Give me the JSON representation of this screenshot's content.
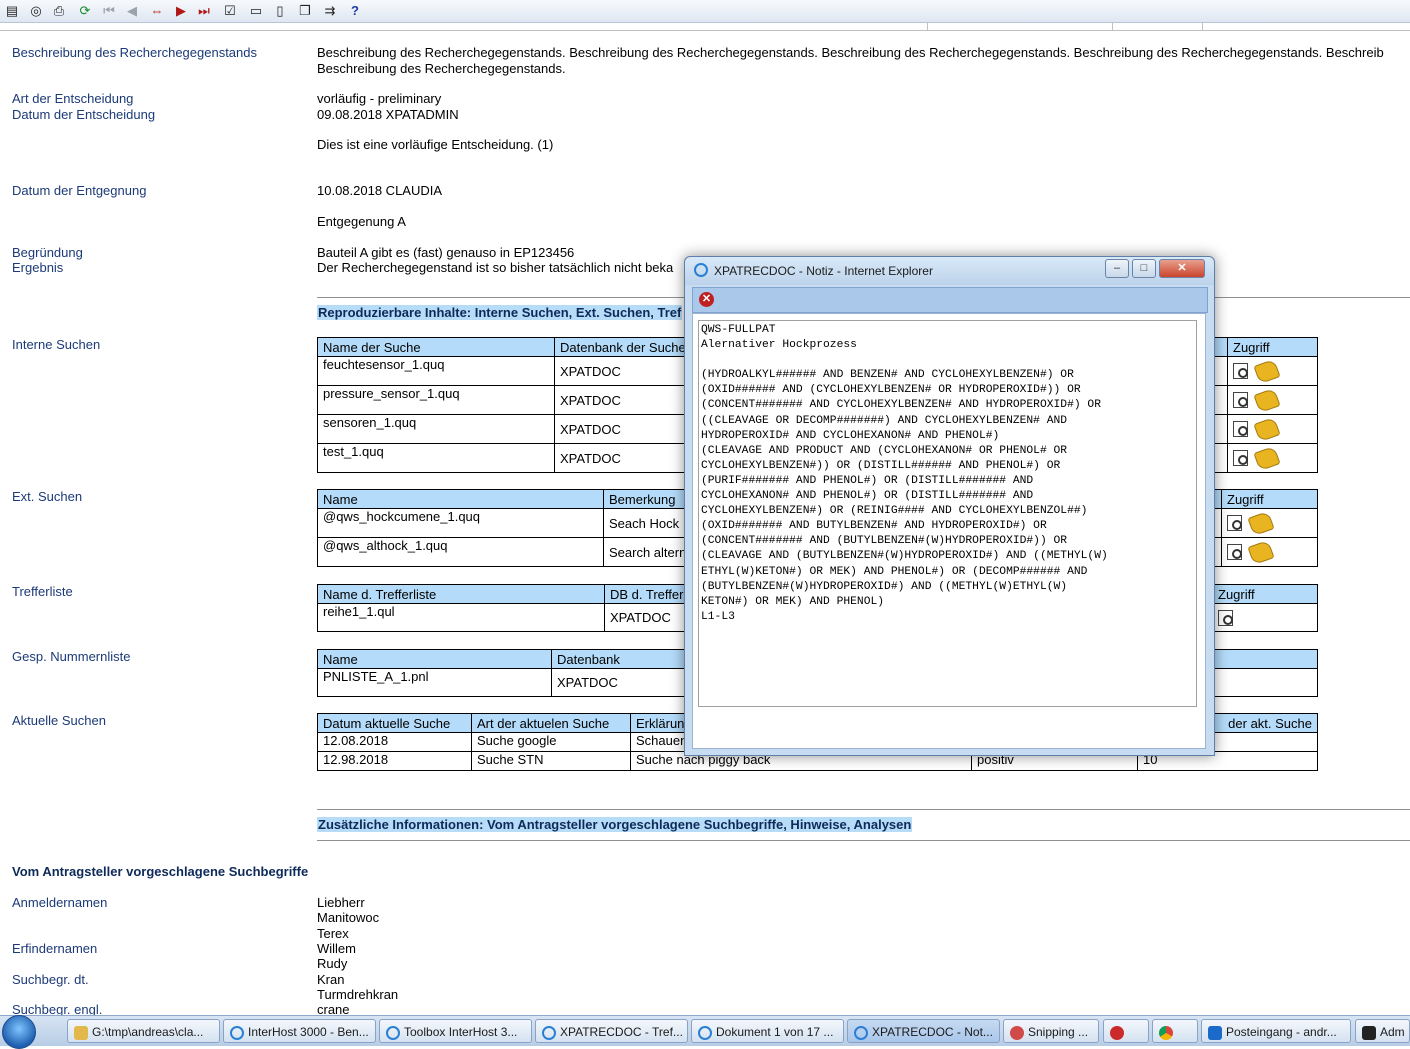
{
  "toolbar": {
    "icons": [
      "save-icon",
      "binoculars-icon",
      "print-icon",
      "refresh-icon",
      "first-icon",
      "prev-icon",
      "swap-icon",
      "next-icon",
      "last-icon",
      "edit-icon",
      "folder-icon",
      "document-icon",
      "copy-icon",
      "search-forward-icon",
      "help-icon"
    ],
    "help_glyph": "?"
  },
  "fields": {
    "beschreibung_label": "Beschreibung des Recherchegegenstands",
    "beschreibung_line1": "Beschreibung des Recherchegegenstands. Beschreibung des Recherchegegenstands. Beschreibung des Recherchegegenstands. Beschreibung des Recherchegegenstands. Beschreib",
    "beschreibung_line2": "Beschreibung des Recherchegegenstands.",
    "art_label": "Art der Entscheidung",
    "art_value": "vorläufig - preliminary",
    "datum_label": "Datum der Entscheidung",
    "datum_value": "09.08.2018  XPATADMIN",
    "entscheidung_text": "Dies ist eine vorläufige Entscheidung. (1)",
    "entgegnung_label": "Datum der Entgegnung",
    "entgegnung_value": "10.08.2018  CLAUDIA",
    "entgegnung_text": "Entgegenung A",
    "begruendung_label": "Begründung",
    "begruendung_value": "Bauteil A gibt es (fast) genauso in EP123456",
    "ergebnis_label": "Ergebnis",
    "ergebnis_value": "Der Recherchegegenstand ist so bisher tatsächlich nicht beka"
  },
  "sections": {
    "reproduzierbar": "Reproduzierbare Inhalte: Interne Suchen, Ext. Suchen, Tref",
    "zusatz": "Zusätzliche Informationen: Vom Antragsteller vorgeschlagene Suchbegriffe, Hinweise, Analysen"
  },
  "interne": {
    "label": "Interne Suchen",
    "headers": [
      "Name der Suche",
      "Datenbank der Suche",
      "Zugriff"
    ],
    "rows": [
      {
        "name": "feuchtesensor_1.quq",
        "db": "XPATDOC"
      },
      {
        "name": "pressure_sensor_1.quq",
        "db": "XPATDOC"
      },
      {
        "name": "sensoren_1.quq",
        "db": "XPATDOC"
      },
      {
        "name": "test_1.quq",
        "db": "XPATDOC"
      }
    ]
  },
  "ext": {
    "label": "Ext. Suchen",
    "headers": [
      "Name",
      "Bemerkung",
      "Zugriff"
    ],
    "rows": [
      {
        "name": "@qws_hockcumene_1.quq",
        "bem": "Seach Hock"
      },
      {
        "name": "@qws_althock_1.quq",
        "bem": "Search altern"
      }
    ]
  },
  "treffer": {
    "label": "Trefferliste",
    "headers": [
      "Name d. Trefferliste",
      "DB d. Trefferliste",
      "Zugriff"
    ],
    "rows": [
      {
        "name": "reihe1_1.qul",
        "db": "XPATDOC"
      }
    ]
  },
  "nummern": {
    "label": "Gesp. Nummernliste",
    "headers": [
      "Name",
      "Datenbank"
    ],
    "rows": [
      {
        "name": "PNLISTE_A_1.pnl",
        "db": "XPATDOC"
      }
    ]
  },
  "aktuelle": {
    "label": "Aktuelle Suchen",
    "headers": [
      "Datum aktuelle Suche",
      "Art der aktuelen Suche",
      "Erklärung",
      "",
      "der akt. Suche"
    ],
    "rows": [
      {
        "datum": "12.08.2018",
        "art": "Suche google",
        "erkl": "Schauen",
        "c4": "",
        "c5": ""
      },
      {
        "datum": "12.98.2018",
        "art": "Suche STN",
        "erkl": "Suche nach piggy back",
        "c4": "positiv",
        "c5": "10"
      }
    ]
  },
  "vorschlag": {
    "heading": "Vom Antragsteller vorgeschlagene Suchbegriffe",
    "anmelder_label": "Anmeldernamen",
    "anmelder": [
      "Liebherr",
      "Manitowoc",
      "Terex"
    ],
    "erfinder_label": "Erfindernamen",
    "erfinder": [
      "Willem",
      "Rudy"
    ],
    "dt_label": "Suchbegr. dt.",
    "dt": [
      "Kran",
      "Turmdrehkran"
    ],
    "engl_label": "Suchbegr. engl.",
    "engl": [
      "crane"
    ]
  },
  "popup": {
    "title": "XPATRECDOC - Notiz - Internet Explorer",
    "note": "QWS-FULLPAT\nAlernativer Hockprozess\n\n(HYDROALKYL###### AND BENZEN# AND CYCLOHEXYLBENZEN#) OR\n(OXID###### AND (CYCLOHEXYLBENZEN# OR HYDROPEROXID#)) OR\n(CONCENT####### AND CYCLOHEXYLBENZEN# AND HYDROPEROXID#) OR\n((CLEAVAGE OR DECOMP#######) AND CYCLOHEXYLBENZEN# AND\nHYDROPEROXID# AND CYCLOHEXANON# AND PHENOL#)\n(CLEAVAGE AND PRODUCT AND (CYCLOHEXANON# OR PHENOL# OR\nCYCLOHEXYLBENZEN#)) OR (DISTILL###### AND PHENOL#) OR\n(PURIF####### AND PHENOL#) OR (DISTILL####### AND\nCYCLOHEXANON# AND PHENOL#) OR (DISTILL####### AND\nCYCLOHEXYLBENZEN#) OR (REINIG#### AND CYCLOHEXYLBENZOL##)\n(OXID####### AND BUTYLBENZEN# AND HYDROPEROXID#) OR\n(CONCENT####### AND (BUTYLBENZEN#(W)HYDROPEROXID#)) OR\n(CLEAVAGE AND (BUTYLBENZEN#(W)HYDROPEROXID#) AND ((METHYL(W)\nETHYL(W)KETON#) OR MEK) AND PHENOL#) OR (DECOMP###### AND\n(BUTYLBENZEN#(W)HYDROPEROXID#) AND ((METHYL(W)ETHYL(W)\nKETON#) OR MEK) AND PHENOL)\nL1-L3"
  },
  "taskbar": {
    "items": [
      "G:\\tmp\\andreas\\cla...",
      "InterHost 3000 - Ben...",
      "Toolbox InterHost 3...",
      "XPATRECDOC - Tref...",
      "Dokument 1 von 17 ...",
      "XPATRECDOC - Not...",
      "Snipping ...",
      "",
      "",
      "Posteingang - andr...",
      "Adm"
    ]
  }
}
